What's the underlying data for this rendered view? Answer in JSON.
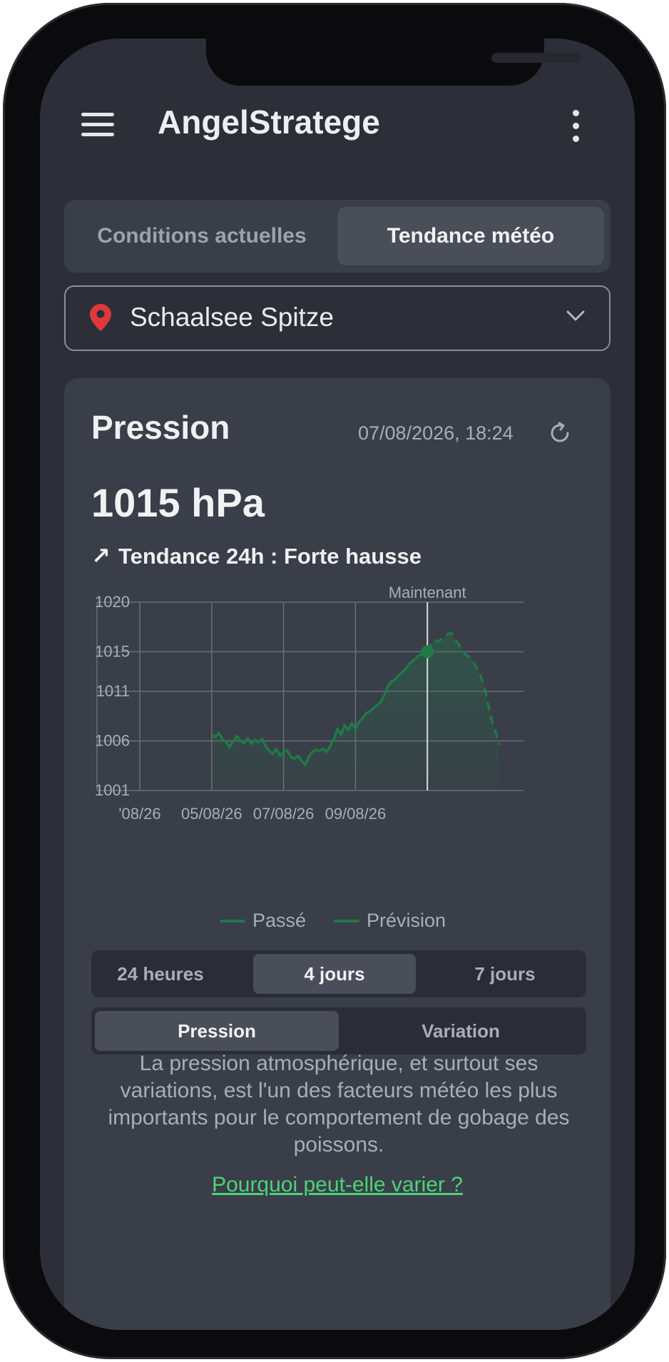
{
  "app": {
    "title": "AngelStratege",
    "menu_icon": "menu-icon",
    "more_icon": "more-vertical-icon"
  },
  "tabs": [
    {
      "label": "Conditions actuelles",
      "active": false
    },
    {
      "label": "Tendance météo",
      "active": true
    }
  ],
  "location": {
    "name": "Schaalsee Spitze",
    "pin_icon": "map-pin-icon",
    "pin_color": "#e0383b",
    "dropdown_icon": "chevron-down-icon"
  },
  "card": {
    "title": "Pression",
    "timestamp": "07/08/2026, 18:24",
    "refresh_icon": "refresh-icon",
    "value": "1015 hPa",
    "trend_arrow": "↗",
    "trend_text": "Tendance 24h : Forte hausse"
  },
  "chart_data": {
    "type": "area",
    "now_label": "Maintenant",
    "y_ticks": [
      "1020",
      "1015",
      "1011",
      "1006",
      "1001"
    ],
    "x_ticks": [
      "'08/26",
      "05/08/26",
      "07/08/26",
      "09/08/26"
    ],
    "ylim": [
      1001,
      1020
    ],
    "grid": true,
    "legend_position": "bottom",
    "line_color": "#1f7a47",
    "series": [
      {
        "name": "Passé",
        "style": "solid",
        "points": [
          [
            0,
            1006.6
          ],
          [
            2,
            1006.4
          ],
          [
            4,
            1006.8
          ],
          [
            6,
            1006.2
          ],
          [
            8,
            1005.9
          ],
          [
            10,
            1005.4
          ],
          [
            12,
            1006.0
          ],
          [
            14,
            1006.5
          ],
          [
            16,
            1006.0
          ],
          [
            18,
            1005.8
          ],
          [
            20,
            1006.3
          ],
          [
            22,
            1005.7
          ],
          [
            24,
            1006.1
          ],
          [
            26,
            1005.9
          ],
          [
            28,
            1006.2
          ],
          [
            30,
            1005.5
          ],
          [
            32,
            1005.0
          ],
          [
            34,
            1004.7
          ],
          [
            36,
            1005.2
          ],
          [
            38,
            1004.5
          ],
          [
            40,
            1004.9
          ],
          [
            42,
            1005.1
          ],
          [
            44,
            1004.4
          ],
          [
            46,
            1004.2
          ],
          [
            48,
            1004.5
          ],
          [
            50,
            1004.0
          ],
          [
            52,
            1003.6
          ],
          [
            54,
            1004.4
          ],
          [
            56,
            1004.9
          ],
          [
            58,
            1005.1
          ],
          [
            60,
            1005.0
          ],
          [
            62,
            1005.2
          ],
          [
            64,
            1004.9
          ],
          [
            66,
            1005.5
          ],
          [
            68,
            1006.2
          ],
          [
            70,
            1007.2
          ],
          [
            72,
            1006.6
          ],
          [
            74,
            1007.6
          ],
          [
            76,
            1007.1
          ],
          [
            78,
            1007.8
          ],
          [
            80,
            1007.2
          ],
          [
            82,
            1007.9
          ],
          [
            84,
            1008.3
          ],
          [
            86,
            1008.8
          ],
          [
            88,
            1009.0
          ],
          [
            90,
            1009.3
          ],
          [
            92,
            1009.6
          ],
          [
            94,
            1009.9
          ],
          [
            96,
            1010.6
          ],
          [
            98,
            1011.5
          ],
          [
            100,
            1012.0
          ],
          [
            102,
            1012.2
          ],
          [
            104,
            1012.6
          ],
          [
            106,
            1012.9
          ],
          [
            108,
            1013.3
          ],
          [
            110,
            1013.8
          ],
          [
            112,
            1014.1
          ],
          [
            114,
            1014.4
          ],
          [
            116,
            1014.7
          ],
          [
            118,
            1014.9
          ],
          [
            120,
            1015.0
          ]
        ]
      },
      {
        "name": "Prévision",
        "style": "dashed",
        "points": [
          [
            120,
            1015.0
          ],
          [
            122,
            1015.7
          ],
          [
            124,
            1016.2
          ],
          [
            126,
            1016.0
          ],
          [
            128,
            1016.3
          ],
          [
            130,
            1016.5
          ],
          [
            132,
            1016.9
          ],
          [
            134,
            1016.8
          ],
          [
            136,
            1016.1
          ],
          [
            138,
            1015.6
          ],
          [
            140,
            1015.0
          ],
          [
            142,
            1014.6
          ],
          [
            144,
            1014.4
          ],
          [
            146,
            1013.8
          ],
          [
            148,
            1013.2
          ],
          [
            150,
            1012.4
          ],
          [
            152,
            1011.2
          ],
          [
            154,
            1009.5
          ],
          [
            156,
            1008.0
          ],
          [
            158,
            1006.9
          ],
          [
            160,
            1005.6
          ]
        ]
      }
    ],
    "now_x": 120,
    "x_tick_positions": [
      0,
      40,
      80,
      120,
      160
    ],
    "x_range": [
      -40,
      160
    ]
  },
  "range_tabs": [
    {
      "label": "24 heures",
      "active": false
    },
    {
      "label": "4 jours",
      "active": true
    },
    {
      "label": "7 jours",
      "active": false
    }
  ],
  "mode_tabs": [
    {
      "label": "Pression",
      "active": true
    },
    {
      "label": "Variation",
      "active": false
    }
  ],
  "description": "La pression atmosphérique, et surtout ses variations, est l'un des facteurs météo les plus importants pour le comportement de gobage des poissons.",
  "link_text": "Pourquoi peut-elle varier ?"
}
